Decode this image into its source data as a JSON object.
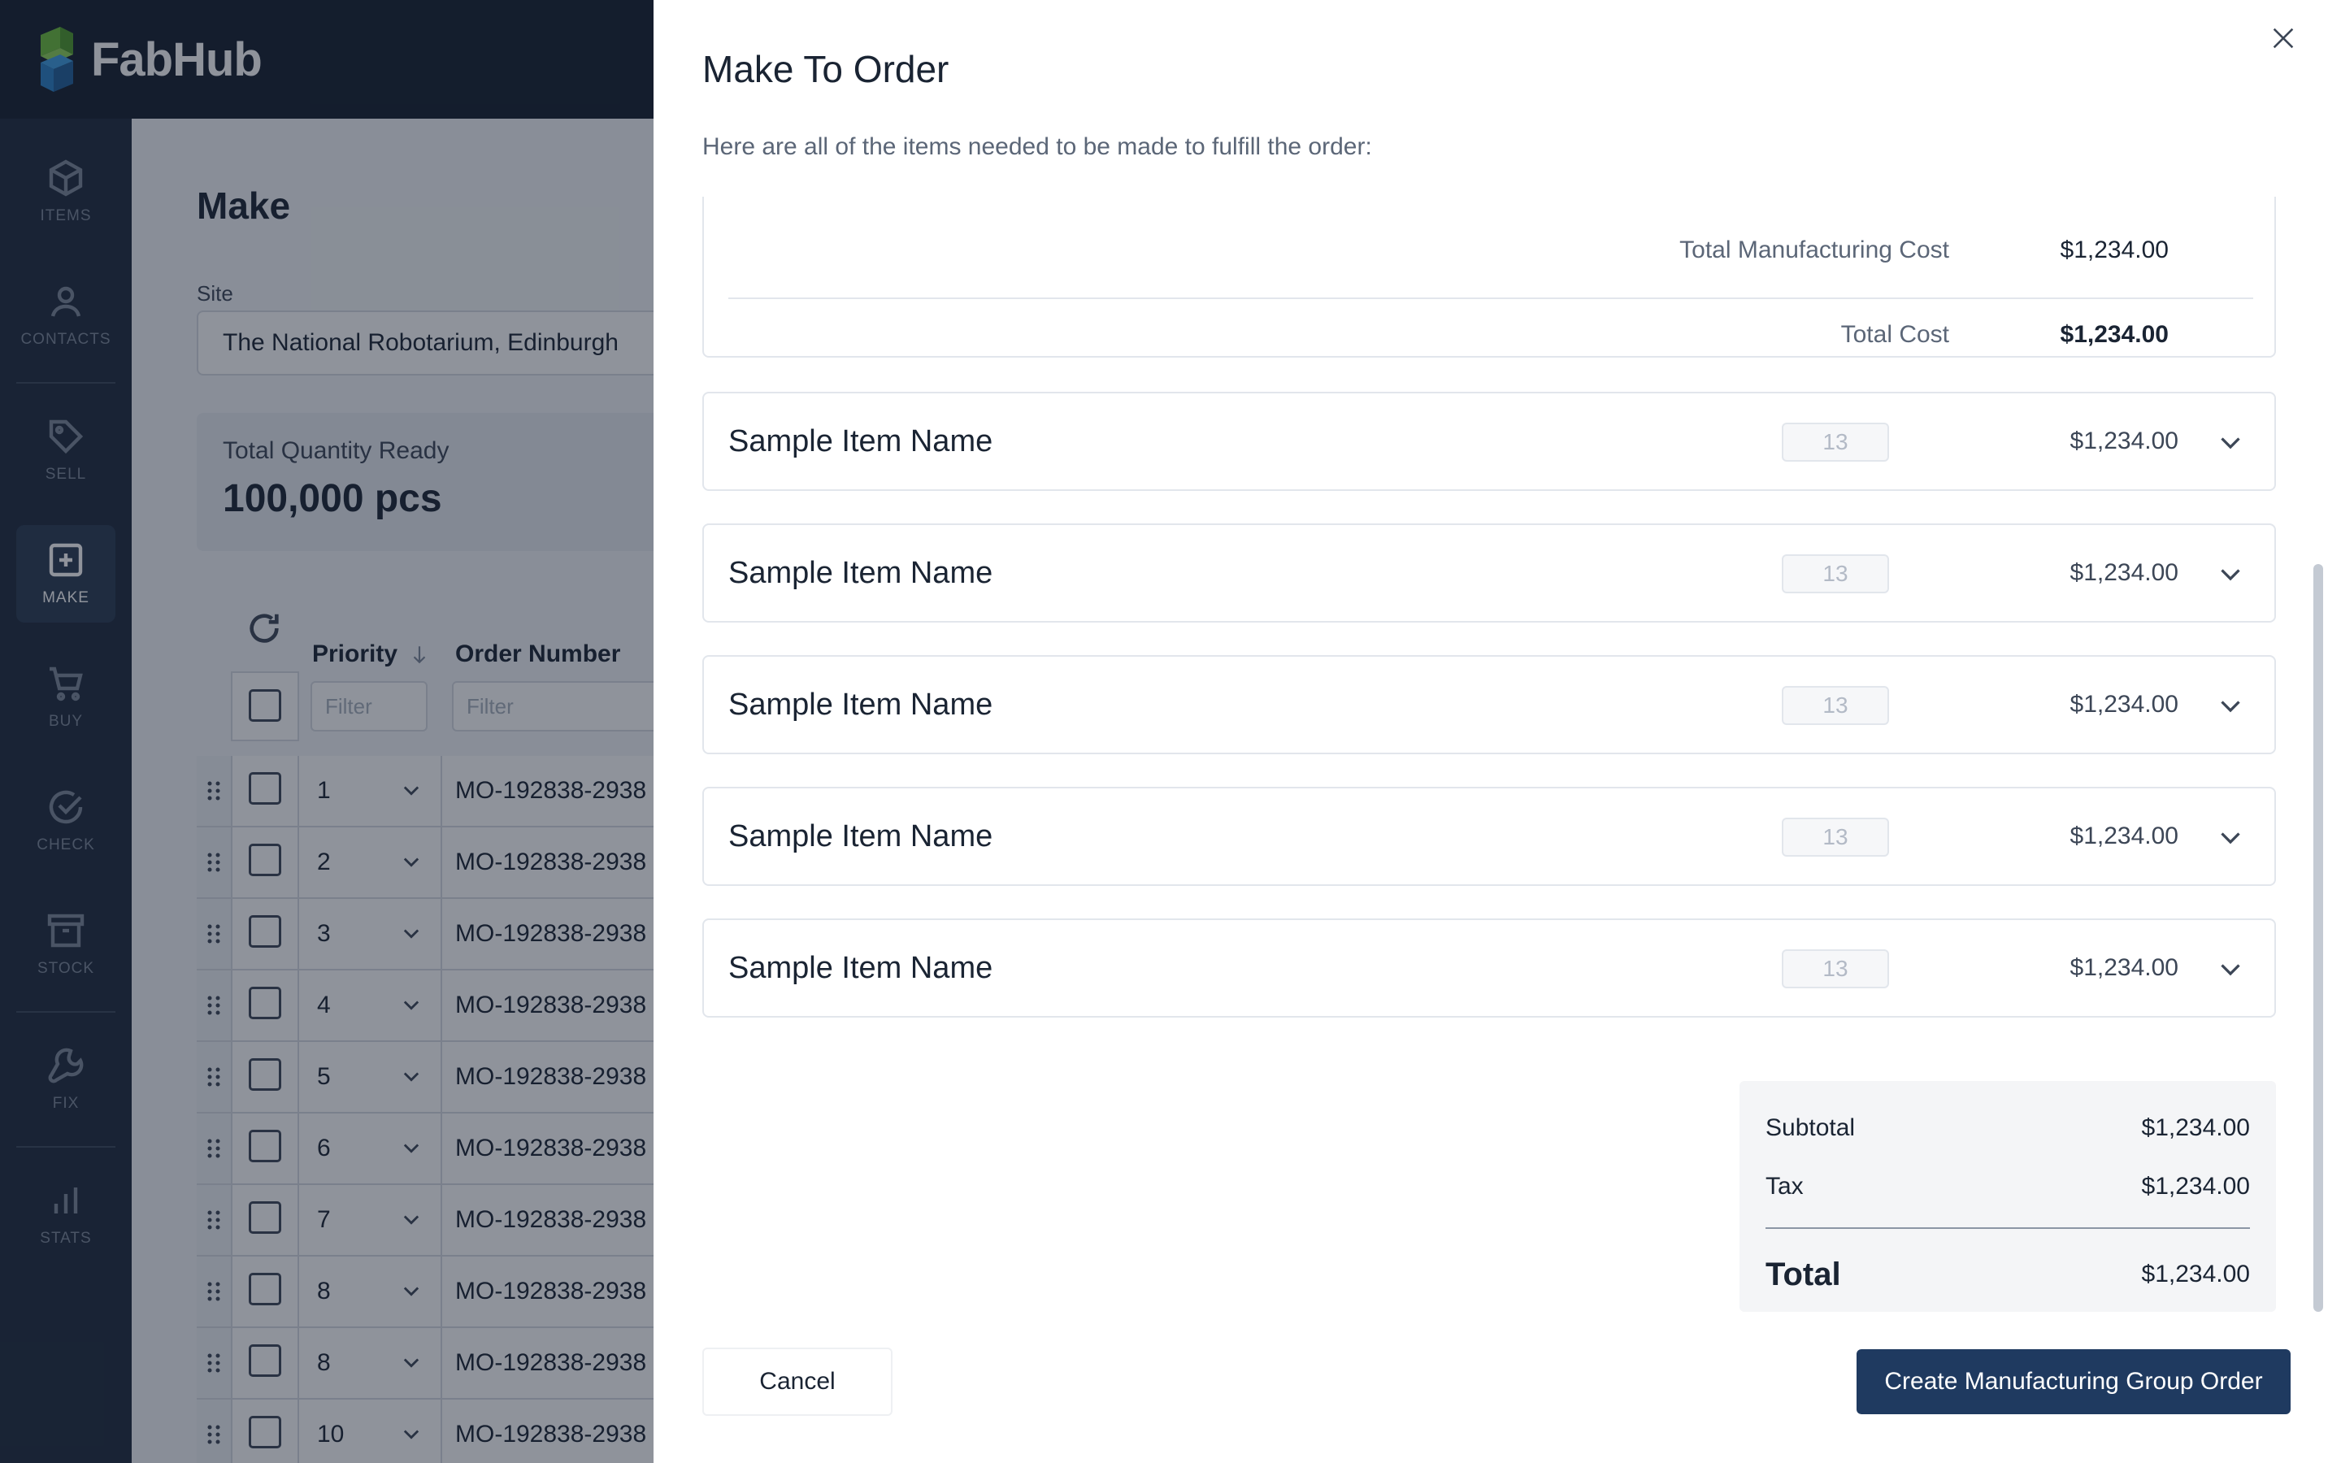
{
  "app": {
    "name": "FabHub"
  },
  "nav": {
    "items": [
      {
        "label": "ITEMS",
        "icon": "cube-icon"
      },
      {
        "label": "CONTACTS",
        "icon": "person-icon"
      },
      {
        "label": "SELL",
        "icon": "tag-icon"
      },
      {
        "label": "MAKE",
        "icon": "plus-square-icon",
        "active": true
      },
      {
        "label": "BUY",
        "icon": "cart-icon"
      },
      {
        "label": "CHECK",
        "icon": "check-circle-icon"
      },
      {
        "label": "STOCK",
        "icon": "archive-icon"
      },
      {
        "label": "FIX",
        "icon": "wrench-icon"
      },
      {
        "label": "STATS",
        "icon": "bar-chart-icon"
      }
    ]
  },
  "page": {
    "title": "Make",
    "site_label": "Site",
    "site_value": "The National Robotarium, Edinburgh",
    "qty_label": "Total Quantity Ready",
    "qty_value": "100,000 pcs"
  },
  "table": {
    "columns": {
      "priority": "Priority",
      "order_number": "Order Number"
    },
    "filter_placeholder": "Filter",
    "rows": [
      {
        "priority": "1",
        "order": "MO-192838-2938"
      },
      {
        "priority": "2",
        "order": "MO-192838-2938"
      },
      {
        "priority": "3",
        "order": "MO-192838-2938"
      },
      {
        "priority": "4",
        "order": "MO-192838-2938"
      },
      {
        "priority": "5",
        "order": "MO-192838-2938"
      },
      {
        "priority": "6",
        "order": "MO-192838-2938"
      },
      {
        "priority": "7",
        "order": "MO-192838-2938"
      },
      {
        "priority": "8",
        "order": "MO-192838-2938"
      },
      {
        "priority": "8",
        "order": "MO-192838-2938"
      },
      {
        "priority": "10",
        "order": "MO-192838-2938"
      }
    ]
  },
  "modal": {
    "title": "Make To Order",
    "subtitle": "Here are all of the items needed to be made to fulfill the order:",
    "summary": {
      "manufacturing_label": "Total Manufacturing Cost",
      "manufacturing_value": "$1,234.00",
      "total_cost_label": "Total Cost",
      "total_cost_value": "$1,234.00"
    },
    "items": [
      {
        "name": "Sample Item Name",
        "qty": "13",
        "price": "$1,234.00"
      },
      {
        "name": "Sample Item Name",
        "qty": "13",
        "price": "$1,234.00"
      },
      {
        "name": "Sample Item Name",
        "qty": "13",
        "price": "$1,234.00"
      },
      {
        "name": "Sample Item Name",
        "qty": "13",
        "price": "$1,234.00"
      },
      {
        "name": "Sample Item Name",
        "qty": "13",
        "price": "$1,234.00"
      }
    ],
    "totals": {
      "subtotal_label": "Subtotal",
      "subtotal_value": "$1,234.00",
      "tax_label": "Tax",
      "tax_value": "$1,234.00",
      "total_label": "Total",
      "total_value": "$1,234.00"
    },
    "cancel_label": "Cancel",
    "create_label": "Create Manufacturing Group Order"
  },
  "colors": {
    "sidebar": "#1e2a3c",
    "topbar": "#141e2d",
    "primary_button": "#1f3a60",
    "logo_green": "#6bbf3b",
    "logo_blue": "#2a7fc6"
  }
}
